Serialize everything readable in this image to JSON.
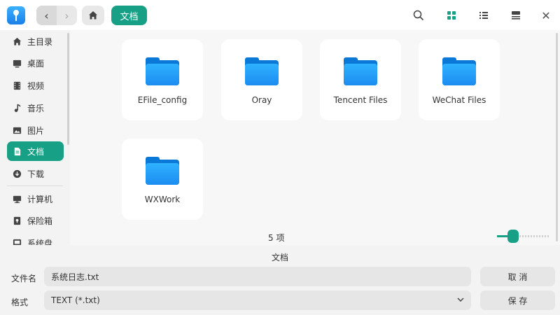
{
  "toolbar": {
    "back_icon": "chevron-left-icon",
    "forward_icon": "chevron-right-icon",
    "home_icon": "home-icon",
    "breadcrumb": "文档",
    "search_icon": "search-icon",
    "grid_view_icon": "grid-view-icon",
    "list_view_icon": "list-view-icon",
    "detail_view_icon": "detail-view-icon",
    "close_icon": "close-icon"
  },
  "sidebar": {
    "items": [
      {
        "label": "主目录",
        "icon": "home-icon"
      },
      {
        "label": "桌面",
        "icon": "desktop-icon"
      },
      {
        "label": "视频",
        "icon": "video-icon"
      },
      {
        "label": "音乐",
        "icon": "music-icon"
      },
      {
        "label": "图片",
        "icon": "picture-icon"
      },
      {
        "label": "文档",
        "icon": "document-icon",
        "active": true
      },
      {
        "label": "下载",
        "icon": "download-icon"
      },
      {
        "label": "计算机",
        "icon": "computer-icon"
      },
      {
        "label": "保险箱",
        "icon": "vault-icon"
      },
      {
        "label": "系统盘",
        "icon": "disk-icon"
      }
    ]
  },
  "files": {
    "items": [
      {
        "name": "EFile_config",
        "icon": "folder-icon"
      },
      {
        "name": "Oray",
        "icon": "folder-icon"
      },
      {
        "name": "Tencent Files",
        "icon": "folder-icon"
      },
      {
        "name": "WeChat Files",
        "icon": "folder-icon"
      },
      {
        "name": "WXWork",
        "icon": "folder-icon"
      }
    ],
    "count_label": "5 项",
    "zoom_level": 0.25
  },
  "dialog": {
    "folder_title": "文档",
    "filename_label": "文件名",
    "filename_value": "系统日志.txt",
    "format_label": "格式",
    "format_value": "TEXT (*.txt)",
    "cancel_label": "取 消",
    "save_label": "保 存"
  },
  "colors": {
    "accent": "#17a085",
    "folder": "#1b8cf0"
  }
}
